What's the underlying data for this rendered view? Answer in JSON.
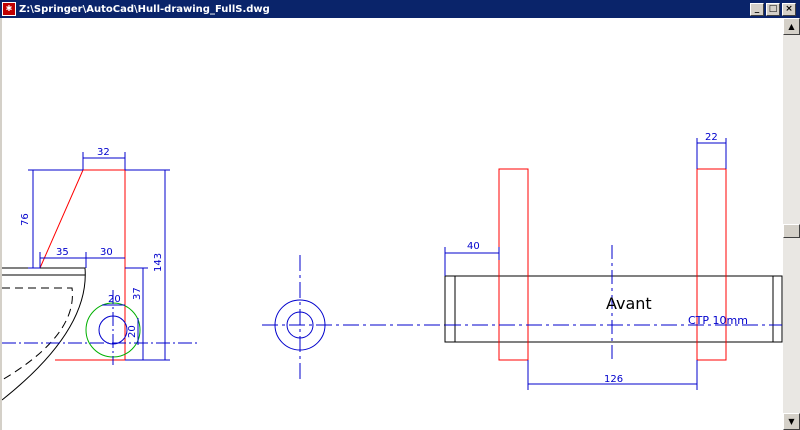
{
  "window": {
    "title": "Z:\\Springer\\AutoCad\\Hull-drawing_FullS.dwg",
    "app_icon": "autocad-icon",
    "buttons": {
      "minimize": "_",
      "maximize": "□",
      "close": "×"
    }
  },
  "drawing": {
    "dimensions": {
      "d32": "32",
      "d76": "76",
      "d35": "35",
      "d30": "30",
      "d143": "143",
      "d20a": "20",
      "d37": "37",
      "d20b": "20",
      "d40": "40",
      "d22": "22",
      "d126": "126"
    },
    "labels": {
      "avant": "Avant",
      "ctp": "CTP 10mm"
    },
    "colors": {
      "outline": "#000000",
      "part": "#ff0000",
      "dimension": "#0000cc",
      "circle": "#00b000"
    }
  },
  "scrollbar": {
    "up": "▲",
    "down": "▼"
  }
}
